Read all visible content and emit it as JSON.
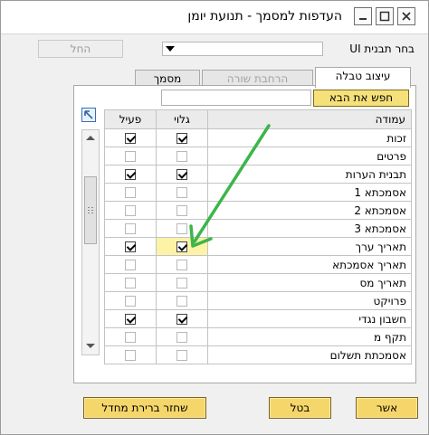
{
  "window": {
    "title": "העדפות למסמך - תנועת יומן",
    "minimize_icon": "minimize-icon",
    "maximize_icon": "maximize-icon",
    "close_icon": "close-icon"
  },
  "template": {
    "label": "בחר תבנית UI",
    "selected": "",
    "apply_label": "החל"
  },
  "tabs": [
    {
      "label": "עיצוב טבלה",
      "state": "active"
    },
    {
      "label": "הרחבת שורה",
      "state": "disabled"
    },
    {
      "label": "מסמך",
      "state": "inactive"
    }
  ],
  "search": {
    "button_label": "חפש את הבא",
    "value": ""
  },
  "grid": {
    "headers": {
      "column": "עמודה",
      "visible": "גלוי",
      "active": "פעיל"
    },
    "rows": [
      {
        "name": "זכות",
        "visible": true,
        "active": true,
        "enabled": true
      },
      {
        "name": "פרטים",
        "visible": false,
        "active": false,
        "enabled": false
      },
      {
        "name": "תבנית הערות",
        "visible": true,
        "active": true,
        "enabled": true
      },
      {
        "name": "אסמכתא 1",
        "visible": false,
        "active": false,
        "enabled": false
      },
      {
        "name": "אסמכתא 2",
        "visible": false,
        "active": false,
        "enabled": false
      },
      {
        "name": "אסמכתא 3",
        "visible": false,
        "active": false,
        "enabled": false
      },
      {
        "name": "תאריך ערך",
        "visible": true,
        "active": true,
        "enabled": true,
        "highlight": true
      },
      {
        "name": "תאריך אסמכתא",
        "visible": false,
        "active": false,
        "enabled": false
      },
      {
        "name": "תאריך מס",
        "visible": false,
        "active": false,
        "enabled": false
      },
      {
        "name": "פרויקט",
        "visible": false,
        "active": false,
        "enabled": false
      },
      {
        "name": "חשבון נגדי",
        "visible": true,
        "active": true,
        "enabled": true
      },
      {
        "name": "תקף מ",
        "visible": false,
        "active": false,
        "enabled": false
      },
      {
        "name": "אסמכתת תשלום",
        "visible": false,
        "active": false,
        "enabled": false
      }
    ]
  },
  "footer": {
    "ok_label": "אשר",
    "cancel_label": "בטל",
    "reset_label": "שחזר ברירת מחדל"
  },
  "colors": {
    "annotation_arrow": "#3cb54a",
    "button_fill": "#f5d66a",
    "highlight_cell": "#fdf3a7"
  }
}
